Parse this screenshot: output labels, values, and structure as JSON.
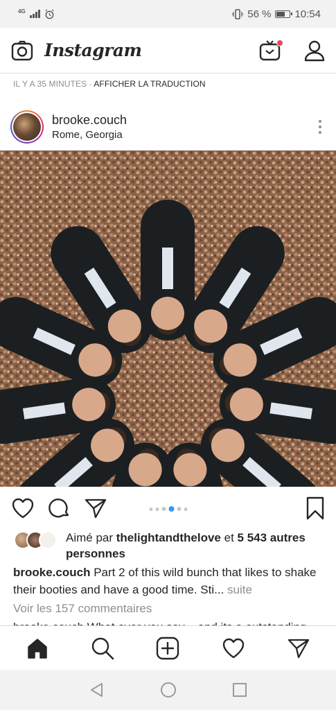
{
  "status_bar": {
    "network": "4G",
    "battery_percent": "56 %",
    "battery_level": 0.56,
    "time": "10:54"
  },
  "nav": {
    "logo": "Instagram",
    "icons": [
      "camera-icon",
      "igtv-icon",
      "profile-icon"
    ],
    "badge_color": "#ed4956"
  },
  "previous_post": {
    "time_ago": "IL Y A 35 MINUTES",
    "separator": "·",
    "translate_link": "AFFICHER LA TRADUCTION"
  },
  "post": {
    "username": "brooke.couch",
    "location": "Rome, Georgia",
    "carousel": {
      "count": 6,
      "active_index": 3
    },
    "likes": {
      "prefix": "Aimé par",
      "user": "thelightandthelove",
      "joiner": "et",
      "others": "5 543 autres personnes"
    },
    "caption": {
      "username": "brooke.couch",
      "text": "Part 2 of this wild bunch that likes to shake their booties and have a good time. Sti...",
      "more_label": "suite"
    },
    "comments_link": "Voir les 157 commentaires",
    "next_line_partial": "brooke.couch What ever you say ...and its a outstanding"
  },
  "tab_bar": {
    "items": [
      "home-icon",
      "search-icon",
      "new-post-icon",
      "activity-icon",
      "direct-icon"
    ]
  },
  "system_nav": {
    "items": [
      "back-icon",
      "home-circle-icon",
      "recents-icon"
    ]
  },
  "colors": {
    "text": "#262626",
    "muted": "#8e8e8e",
    "accent_blue": "#3897f0",
    "divider": "#dbdbdb"
  }
}
